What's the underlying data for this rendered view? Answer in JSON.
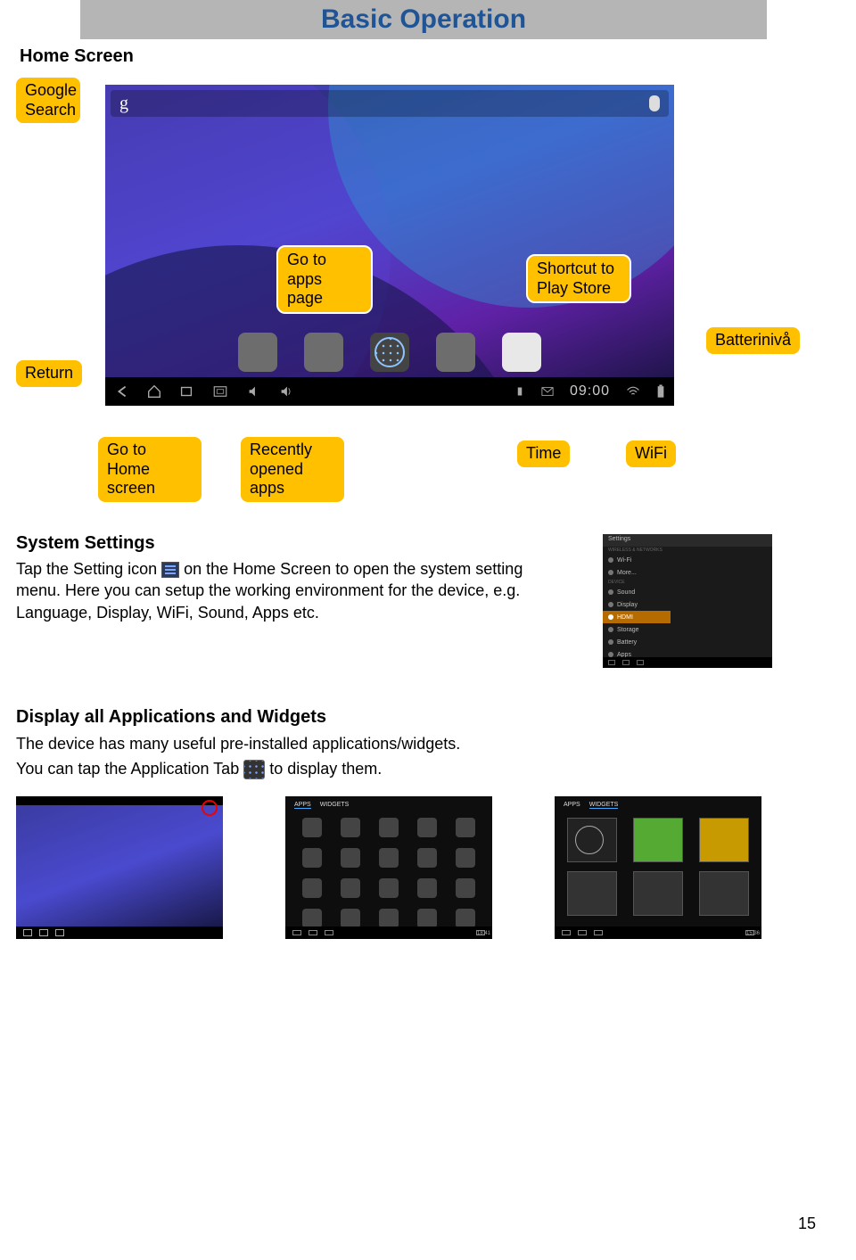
{
  "page": {
    "title": "Basic Operation",
    "home_screen_heading": "Home Screen",
    "page_number": "15"
  },
  "callouts": {
    "google_search": "Google Search",
    "go_to_apps": "Go to apps page",
    "shortcut_play": "Shortcut  to Play Store",
    "batteri": "Batterinivå",
    "return": "Return",
    "go_home": "Go to Home screen",
    "recently": "Recently opened apps",
    "time": "Time",
    "wifi": "WiFi"
  },
  "homescreen": {
    "search_glyph": "g",
    "clock": "09:00"
  },
  "system_settings": {
    "heading": "System Settings",
    "text_before_icon": "Tap the Setting icon ",
    "text_after_icon": " on the Home Screen to open the system setting menu. Here you can setup the working environment for the device, e.g. Language, Display, WiFi, Sound, Apps etc."
  },
  "settings_shot": {
    "title": "Settings",
    "cat1": "WIRELESS & NETWORKS",
    "rows1": [
      "Wi-Fi",
      "More..."
    ],
    "cat2": "DEVICE",
    "rows2": [
      "Sound",
      "Display"
    ],
    "hl": "HDMI",
    "rows3": [
      "Storage",
      "Battery",
      "Apps"
    ]
  },
  "display_apps": {
    "heading": "Display all Applications and Widgets",
    "line1": "The device has many useful pre-installed applications/widgets.",
    "line2_before": "You can tap the Application Tab ",
    "line2_after": " to display them."
  },
  "thumb2": {
    "tab1": "APPS",
    "tab2": "WIDGETS",
    "time": "18:41"
  },
  "thumb3": {
    "tab1": "APPS",
    "tab2": "WIDGETS",
    "time": "15:36"
  }
}
